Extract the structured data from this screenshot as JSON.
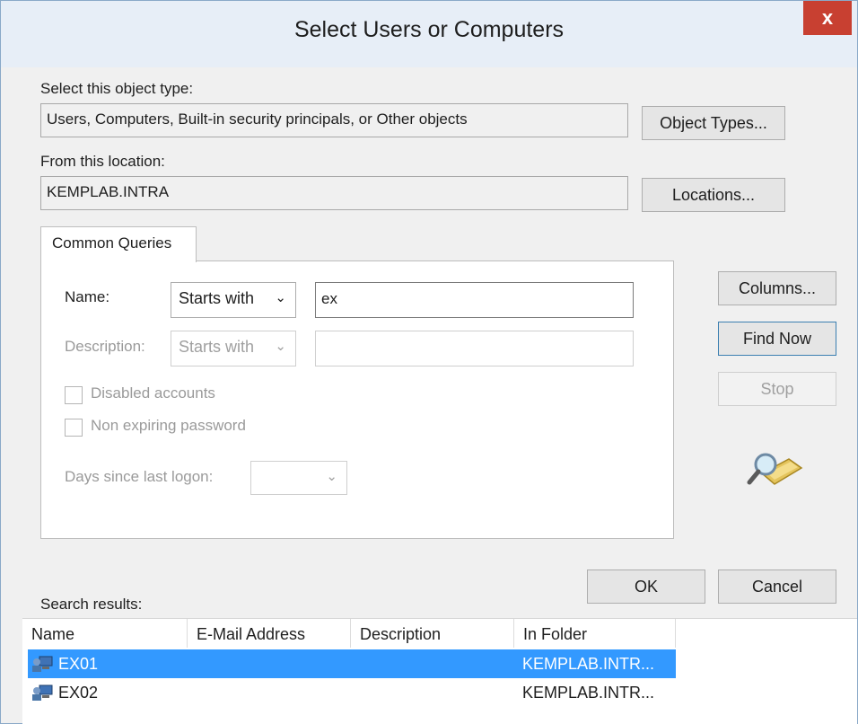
{
  "window": {
    "title": "Select Users or Computers",
    "close_glyph": "x"
  },
  "object_type": {
    "label": "Select this object type:",
    "value": "Users, Computers, Built-in security principals, or Other objects",
    "button": "Object Types..."
  },
  "location": {
    "label": "From this location:",
    "value": "KEMPLAB.INTRA",
    "button": "Locations..."
  },
  "common_queries": {
    "tab_label": "Common Queries",
    "name": {
      "label": "Name:",
      "operator": "Starts with",
      "value": "ex"
    },
    "description": {
      "label": "Description:",
      "operator": "Starts with",
      "value": ""
    },
    "disabled_accounts": {
      "label": "Disabled accounts",
      "checked": false
    },
    "non_expiring_password": {
      "label": "Non expiring password",
      "checked": false
    },
    "days_since_last_logon": {
      "label": "Days since last logon:",
      "value": ""
    }
  },
  "side_buttons": {
    "columns": "Columns...",
    "find_now": "Find Now",
    "stop": "Stop"
  },
  "footer_buttons": {
    "ok": "OK",
    "cancel": "Cancel"
  },
  "results": {
    "label": "Search results:",
    "columns": [
      "Name",
      "E-Mail Address",
      "Description",
      "In Folder"
    ],
    "rows": [
      {
        "name": "EX01",
        "email": "",
        "description": "",
        "folder": "KEMPLAB.INTR...",
        "selected": true
      },
      {
        "name": "EX02",
        "email": "",
        "description": "",
        "folder": "KEMPLAB.INTR...",
        "selected": false
      }
    ]
  },
  "icons": {
    "search": "search-folder-icon",
    "user": "computer-object-icon"
  },
  "colors": {
    "accent": "#3399ff",
    "close": "#c84031",
    "titlebar": "#e7eef7"
  }
}
